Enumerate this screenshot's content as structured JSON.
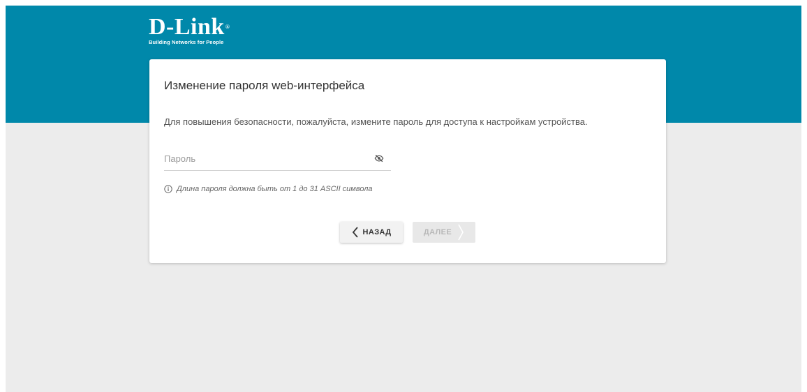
{
  "logo": {
    "brand": "D-Link",
    "registered": "®",
    "tagline": "Building Networks for People"
  },
  "card": {
    "title": "Изменение пароля web-интерфейса",
    "description": "Для повышения безопасности, пожалуйста, измените пароль для доступа к настройкам устройства.",
    "password_field": {
      "placeholder": "Пароль",
      "value": "",
      "visibility_icon": "eye-off-icon"
    },
    "hint": {
      "icon": "info-icon",
      "text": "Длина пароля должна быть от 1 до 31 ASCII символа"
    },
    "buttons": {
      "back_label": "НАЗАД",
      "next_label": "ДАЛЕЕ",
      "next_disabled": true
    }
  },
  "colors": {
    "header": "#0088aa",
    "background": "#ececec",
    "card": "#ffffff"
  }
}
